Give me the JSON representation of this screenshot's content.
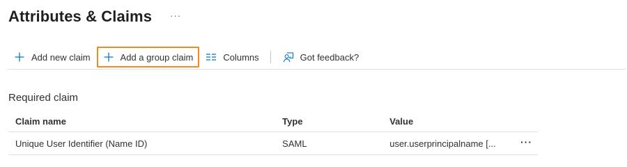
{
  "header": {
    "title": "Attributes & Claims",
    "more_label": "···"
  },
  "toolbar": {
    "items": [
      {
        "label": "Add new claim",
        "icon": "plus-icon"
      },
      {
        "label": "Add a group claim",
        "icon": "plus-icon",
        "focused": true
      },
      {
        "label": "Columns",
        "icon": "columns-icon"
      },
      {
        "label": "Got feedback?",
        "icon": "feedback-icon"
      }
    ]
  },
  "colors": {
    "accent": "#0078d4",
    "focus_outline": "#f08a24",
    "divider": "#e1dfdd"
  },
  "section": {
    "heading": "Required claim"
  },
  "table": {
    "columns": [
      "Claim name",
      "Type",
      "Value"
    ],
    "rows": [
      {
        "claim_name": "Unique User Identifier (Name ID)",
        "type": "SAML",
        "value": "user.userprincipalname [...",
        "more_label": "···"
      }
    ]
  }
}
